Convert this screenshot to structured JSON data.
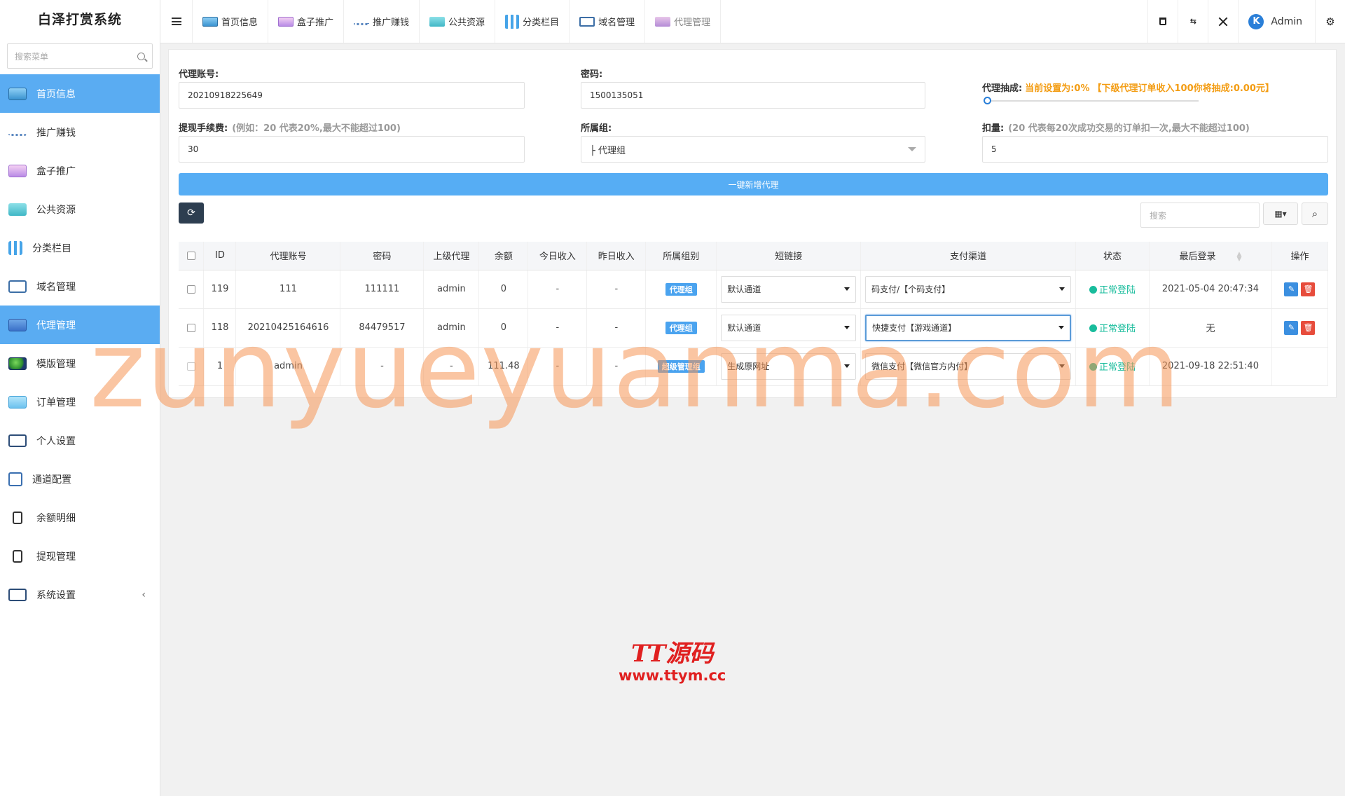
{
  "app": {
    "title": "白泽打赏系统"
  },
  "sidebar": {
    "search_placeholder": "搜索菜单",
    "items": [
      {
        "label": "首页信息",
        "icon": "card-icon"
      },
      {
        "label": "推广赚钱",
        "icon": "link-icon"
      },
      {
        "label": "盒子推广",
        "icon": "box-icon"
      },
      {
        "label": "公共资源",
        "icon": "resource-icon"
      },
      {
        "label": "分类栏目",
        "icon": "sort-icon"
      },
      {
        "label": "域名管理",
        "icon": "domain-icon"
      },
      {
        "label": "代理管理",
        "icon": "agent-icon"
      },
      {
        "label": "模版管理",
        "icon": "template-icon"
      },
      {
        "label": "订单管理",
        "icon": "order-icon"
      },
      {
        "label": "个人设置",
        "icon": "user-icon"
      },
      {
        "label": "通道配置",
        "icon": "channel-icon"
      },
      {
        "label": "余额明细",
        "icon": "balance-icon"
      },
      {
        "label": "提现管理",
        "icon": "withdraw-icon"
      },
      {
        "label": "系统设置",
        "icon": "settings-icon",
        "arrow": "‹"
      }
    ]
  },
  "topbar": {
    "tabs": [
      {
        "label": "首页信息"
      },
      {
        "label": "盒子推广"
      },
      {
        "label": "推广赚钱"
      },
      {
        "label": "公共资源"
      },
      {
        "label": "分类栏目"
      },
      {
        "label": "域名管理"
      },
      {
        "label": "代理管理"
      }
    ],
    "user": {
      "name": "Admin",
      "avatar_letter": "K"
    }
  },
  "form": {
    "account": {
      "label": "代理账号:",
      "value": "20210918225649"
    },
    "password": {
      "label": "密码:",
      "value": "1500135051"
    },
    "commission": {
      "label": "代理抽成:",
      "current": "当前设置为:0%",
      "note": "【下级代理订单收入100你将抽成:0.00元】",
      "value_pct": 0
    },
    "fee": {
      "label": "提现手续费:",
      "hint": "(例如：20 代表20%,最大不能超过100)",
      "value": "30"
    },
    "group": {
      "label": "所属组:",
      "value": "├ 代理组"
    },
    "deduct": {
      "label": "扣量:",
      "hint": "(20 代表每20次成功交易的订单扣一次,最大不能超过100)",
      "value": "5"
    },
    "submit_label": "一键新增代理"
  },
  "toolbar": {
    "refresh_icon": "⟳",
    "search_placeholder": "搜索",
    "columns_icon": "▦▾",
    "search_icon": "⌕"
  },
  "table": {
    "headers": [
      "ID",
      "代理账号",
      "密码",
      "上级代理",
      "余额",
      "今日收入",
      "昨日收入",
      "所属组别",
      "短链接",
      "支付渠道",
      "状态",
      "最后登录",
      "操作"
    ],
    "rows": [
      {
        "id": "119",
        "account": "111",
        "password": "111111",
        "parent": "admin",
        "balance": "0",
        "today": "-",
        "yesterday": "-",
        "group": "代理组",
        "shortlink": "默认通道",
        "channel": "码支付/【个码支付】",
        "status": "正常登陆",
        "last_login": "2021-05-04 20:47:34",
        "has_actions": true
      },
      {
        "id": "118",
        "account": "20210425164616",
        "password": "84479517",
        "parent": "admin",
        "balance": "0",
        "today": "-",
        "yesterday": "-",
        "group": "代理组",
        "shortlink": "默认通道",
        "channel": "快捷支付【游戏通道】",
        "status": "正常登陆",
        "last_login": "无",
        "has_actions": true
      },
      {
        "id": "1",
        "account": "admin",
        "password": "-",
        "parent": "-",
        "balance": "111.48",
        "today": "-",
        "yesterday": "-",
        "group": "超级管理组",
        "shortlink": "生成原网址",
        "channel": "微信支付【微信官方内付】",
        "status": "正常登陆",
        "last_login": "2021-09-18 22:51:40",
        "has_actions": false
      }
    ]
  },
  "watermarks": {
    "main": "zunyueyuanma.com",
    "logo_line1": "TT源码",
    "logo_line2": "www.ttym.cc"
  }
}
